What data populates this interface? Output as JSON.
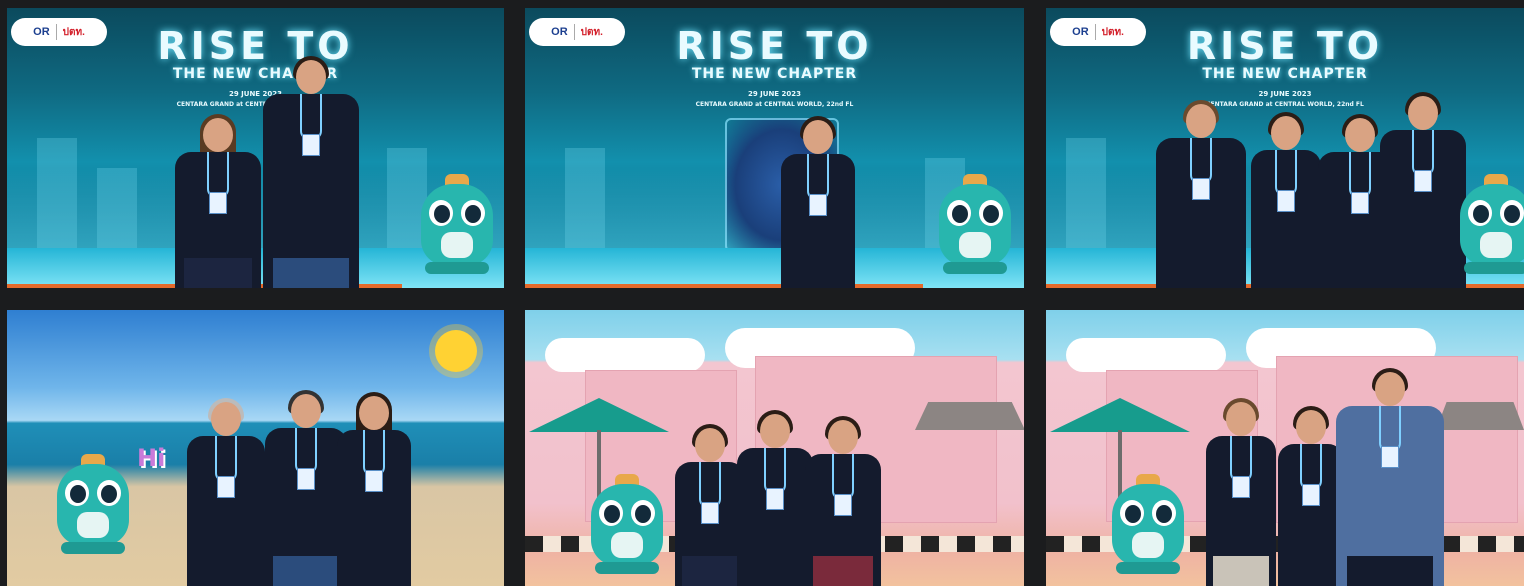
{
  "event": {
    "title_line1": "RISE TO",
    "title_line2": "THE NEW CHAPTER",
    "date": "29 JUNE 2023",
    "venue": "CENTARA GRAND at CENTRAL WORLD, 22nd FL",
    "partial_date": "29 JUNE 2023",
    "partial_venue": "CENTARA GRAND at CENTRAL WORLD, 22nd FL"
  },
  "logo": {
    "brand1": "OR",
    "brand2": "ปตท."
  },
  "beach": {
    "greeting": "Hi"
  },
  "colors": {
    "accent_orange": "#e46a2b",
    "mascot_teal": "#28b6ae",
    "backdrop_teal": "#1290ad"
  }
}
